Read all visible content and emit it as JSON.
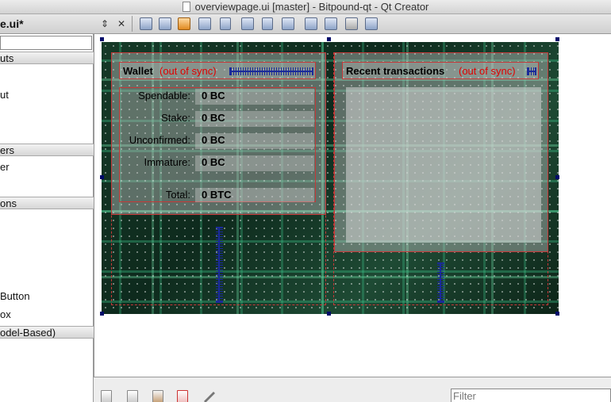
{
  "window": {
    "title": "overviewpage.ui [master] - Bitpound-qt - Qt Creator"
  },
  "toolbar": {
    "file_name": "e.ui*",
    "updown_glyph": "⇕",
    "close_glyph": "✕"
  },
  "left_panel": {
    "categories": [
      "uts",
      "ers",
      "ons",
      "odel-Based)"
    ],
    "items": [
      "ut",
      "er",
      "Button",
      "ox"
    ]
  },
  "form": {
    "wallet": {
      "title": "Wallet",
      "sync_label": "(out of sync)",
      "balances": [
        {
          "label": "Spendable:",
          "value": "0 BC"
        },
        {
          "label": "Stake:",
          "value": "0 BC"
        },
        {
          "label": "Unconfirmed:",
          "value": "0 BC"
        },
        {
          "label": "Immature:",
          "value": "0 BC"
        },
        {
          "label": "Total:",
          "value": "0 BTC"
        }
      ]
    },
    "recent": {
      "title": "Recent transactions",
      "sync_label": "(out of sync)"
    }
  },
  "bottom_dock": {
    "filter_placeholder": "Filter"
  },
  "colors": {
    "sync_red": "#e00000",
    "layout_red": "#c63838",
    "spacer_blue": "#1a2a9a",
    "handle_navy": "#000a6a"
  },
  "icons": {
    "toolbar": [
      "updown-icon",
      "close-icon",
      "edit-widgets-icon",
      "edit-signals-icon",
      "edit-buddies-icon",
      "edit-tab-order-icon",
      "layout-horizontal-icon",
      "layout-vertical-icon",
      "splitter-horizontal-icon",
      "splitter-vertical-icon",
      "layout-grid-icon",
      "break-layout-icon",
      "adjust-size-icon"
    ],
    "dock": [
      "new-icon",
      "copy-icon",
      "paste-icon",
      "delete-icon",
      "settings-icon"
    ]
  }
}
